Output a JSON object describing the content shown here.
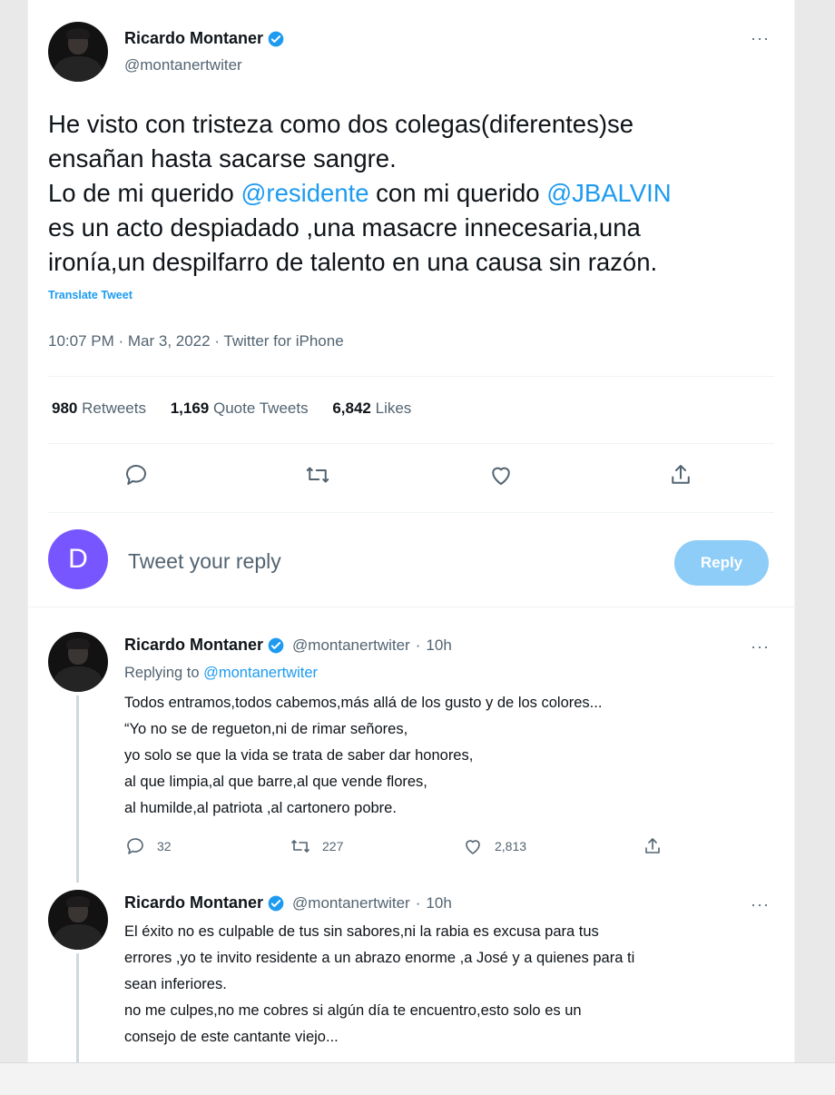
{
  "tweet": {
    "author_name": "Ricardo Montaner",
    "author_handle": "@montanertwiter",
    "more": "···",
    "text_line1": "He visto con tristeza como dos colegas(diferentes)se",
    "text_line2": "ensañan hasta sacarse sangre.",
    "text_line3_a": "Lo de mi querido ",
    "mention_residente": "@residente",
    "text_line3_b": " con mi querido ",
    "mention_jbalvin": "@JBALVIN",
    "text_line4": "es un acto despiadado ,una masacre innecesaria,una",
    "text_line5": "ironía,un despilfarro de talento en una causa sin razón.",
    "translate": "Translate Tweet",
    "meta": "10:07 PM · Mar 3, 2022 · Twitter for iPhone",
    "stats": {
      "retweets_count": "980",
      "retweets_label": "Retweets",
      "quotes_count": "1,169",
      "quotes_label": "Quote Tweets",
      "likes_count": "6,842",
      "likes_label": "Likes"
    }
  },
  "reply_box": {
    "avatar_letter": "D",
    "placeholder": "Tweet your reply",
    "button": "Reply"
  },
  "replies": [
    {
      "author_name": "Ricardo Montaner",
      "author_handle": "@montanertwiter",
      "dot": "·",
      "time": "10h",
      "more": "···",
      "replying_prefix": "Replying to ",
      "replying_handle": "@montanertwiter",
      "lines": [
        "Todos entramos,todos cabemos,más allá de los gusto y de los colores...",
        "“Yo no se de regueton,ni de rimar señores,",
        "yo solo se que la vida se trata de saber dar honores,",
        "al que limpia,al que barre,al que vende flores,",
        "al humilde,al patriota ,al cartonero pobre."
      ],
      "reply_count": "32",
      "retweet_count": "227",
      "like_count": "2,813"
    },
    {
      "author_name": "Ricardo Montaner",
      "author_handle": "@montanertwiter",
      "dot": "·",
      "time": "10h",
      "more": "···",
      "lines": [
        "El éxito no es culpable de tus sin sabores,ni la rabia es excusa para tus",
        "errores ,yo te invito residente a un abrazo enorme ,a José y a quienes para ti",
        "sean inferiores.",
        "no me culpes,no me cobres si algún día te encuentro,esto solo es un",
        "consejo de este cantante viejo..."
      ]
    }
  ],
  "colors": {
    "accent": "#1d9bf0",
    "reply_button": "#8ecdf7",
    "user_avatar": "#7856ff",
    "secondary_text": "#536471"
  },
  "icons": [
    "verified-badge-icon",
    "more-icon",
    "reply-icon",
    "retweet-icon",
    "like-icon",
    "share-icon"
  ]
}
